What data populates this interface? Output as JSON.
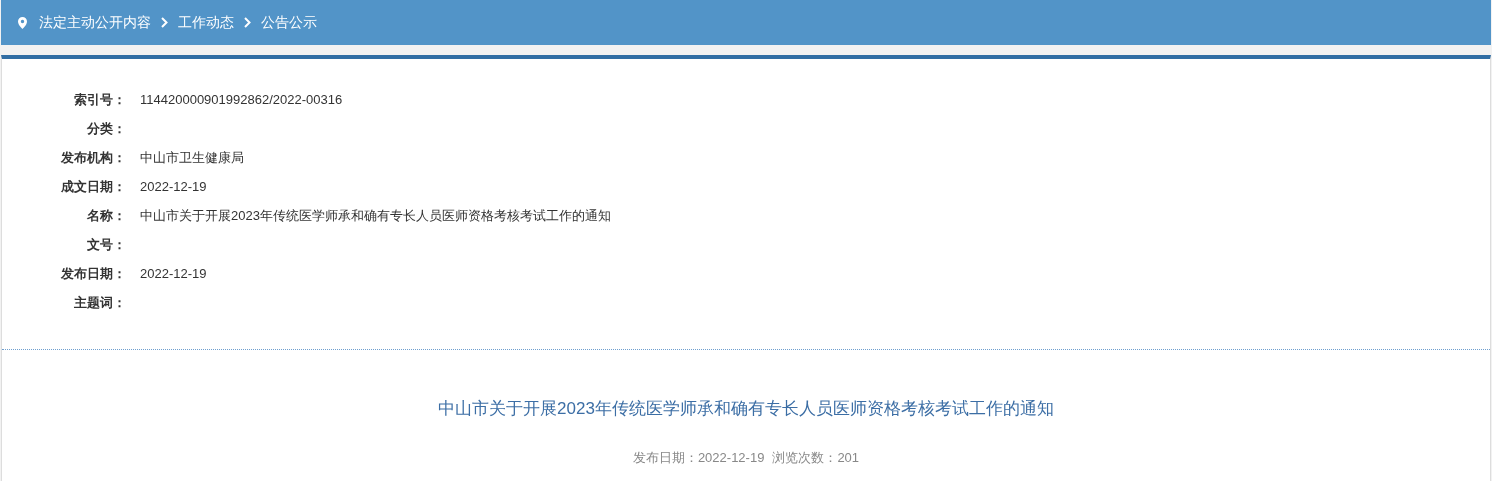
{
  "breadcrumb": [
    "法定主动公开内容",
    "工作动态",
    "公告公示"
  ],
  "fields": [
    {
      "label": "索引号：",
      "value": "114420000901992862/2022-00316"
    },
    {
      "label": "分类："
    },
    {
      "label": "发布机构：",
      "value": "中山市卫生健康局"
    },
    {
      "label": "成文日期：",
      "value": "2022-12-19"
    },
    {
      "label": "名称：",
      "value": "中山市关于开展2023年传统医学师承和确有专长人员医师资格考核考试工作的通知"
    },
    {
      "label": "文号："
    },
    {
      "label": "发布日期：",
      "value": "2022-12-19"
    },
    {
      "label": "主题词："
    }
  ],
  "article": {
    "title": "中山市关于开展2023年传统医学师承和确有专长人员医师资格考核考试工作的通知",
    "meta": [
      "发布日期：2022-12-19",
      "浏览次数：201"
    ]
  }
}
